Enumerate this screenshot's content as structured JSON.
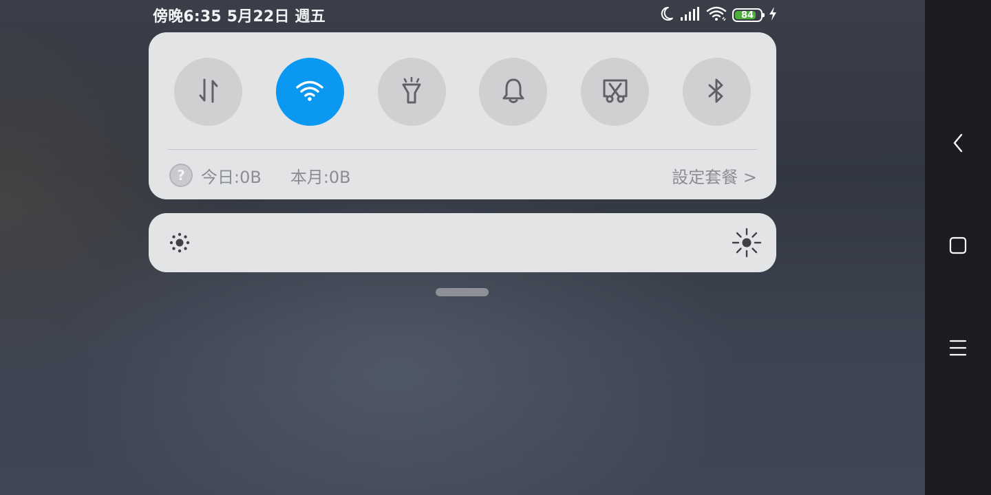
{
  "status_bar": {
    "time_date": "傍晚6:35 5月22日 週五",
    "icons": [
      "moon-icon",
      "signal-icon",
      "wifi-icon",
      "battery-icon",
      "charging-icon"
    ],
    "battery_level": "84",
    "battery_fraction": 0.84,
    "battery_color": "#4caf3a"
  },
  "quick_toggles": [
    {
      "name": "mobile-data",
      "icon": "data-transfer-icon",
      "active": false
    },
    {
      "name": "wifi",
      "icon": "wifi-icon",
      "active": true
    },
    {
      "name": "flashlight",
      "icon": "flashlight-icon",
      "active": false
    },
    {
      "name": "sound",
      "icon": "bell-icon",
      "active": false
    },
    {
      "name": "screenshot",
      "icon": "screenshot-scissors-icon",
      "active": false
    },
    {
      "name": "bluetooth",
      "icon": "bluetooth-icon",
      "active": false
    }
  ],
  "data_usage": {
    "help_glyph": "?",
    "today": "今日:0B",
    "month": "本月:0B",
    "plan_link": "設定套餐 >"
  },
  "brightness": {
    "low_icon": "brightness-low-icon",
    "high_icon": "brightness-high-icon"
  },
  "navigation": {
    "buttons": [
      "back-icon",
      "home-icon",
      "menu-icon"
    ]
  },
  "colors": {
    "accent": "#0a98f2",
    "panel": "#e3e4e6",
    "tile_inactive": "#cfd0d2",
    "icon_gray": "#5f6165"
  }
}
